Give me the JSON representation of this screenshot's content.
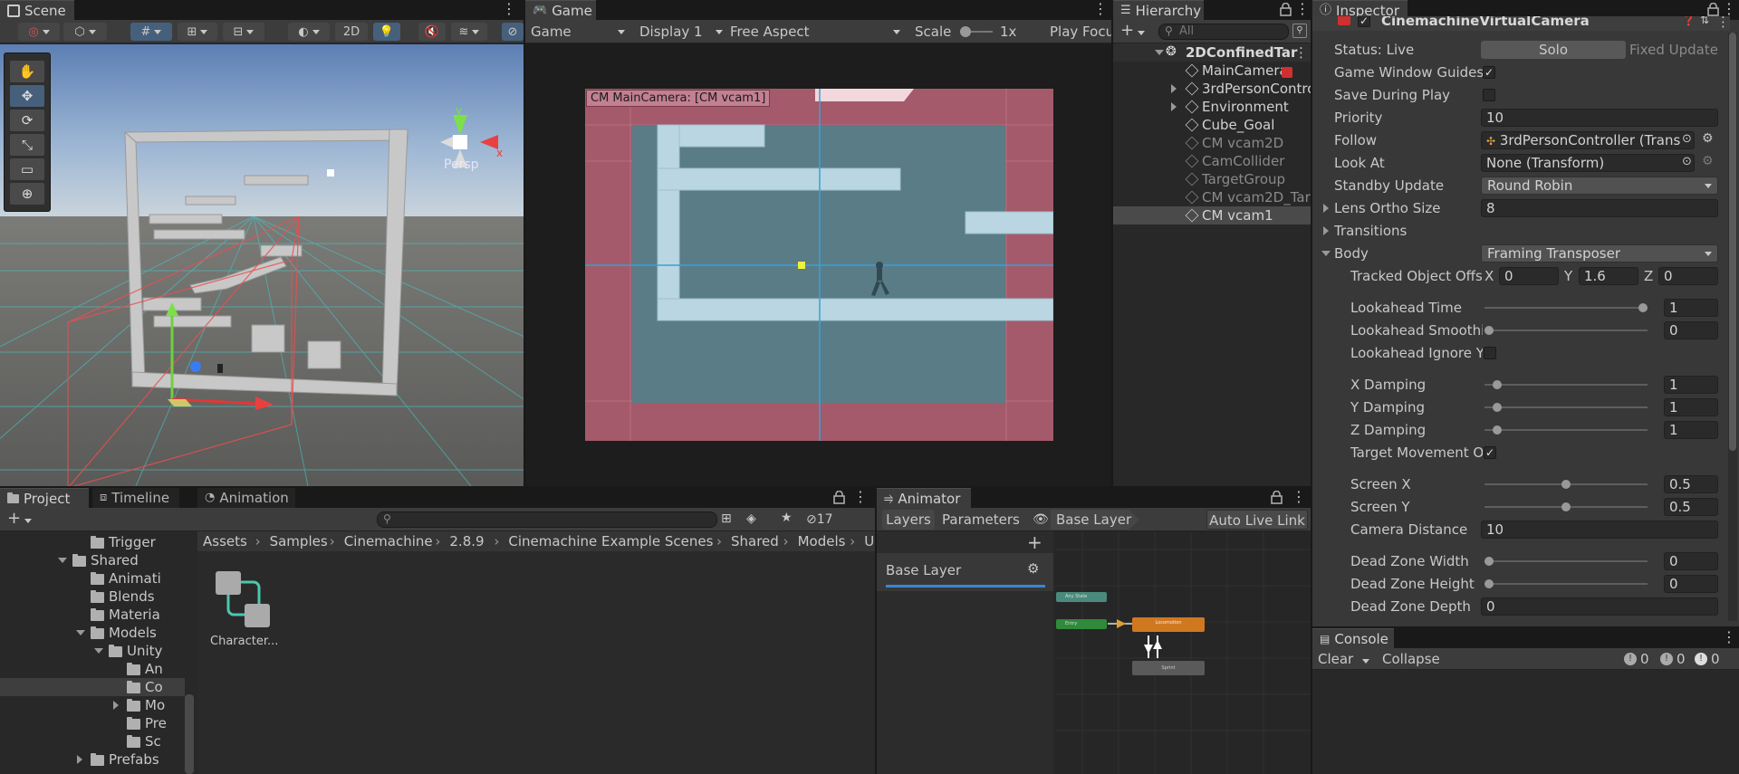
{
  "scene": {
    "tab": "Scene",
    "toolbar": {
      "mode_2d": "2D"
    },
    "persp_label": "Persp"
  },
  "game": {
    "tab": "Game",
    "toolbar": {
      "view": "Game",
      "display": "Display 1",
      "aspect": "Free Aspect",
      "scale_label": "Scale",
      "scale_value": "1x",
      "play_focus": "Play Focu"
    },
    "camera_label": "CM MainCamera: [CM vcam1]"
  },
  "hierarchy": {
    "tab": "Hierarchy",
    "search_placeholder": "All",
    "scene_name": "2DConfinedTar",
    "items": [
      {
        "label": "MainCamera",
        "dim": false,
        "expandable": false
      },
      {
        "label": "3rdPersonContro",
        "dim": false,
        "expandable": true
      },
      {
        "label": "Environment",
        "dim": false,
        "expandable": true
      },
      {
        "label": "Cube_Goal",
        "dim": false,
        "expandable": false
      },
      {
        "label": "CM vcam2D",
        "dim": true,
        "expandable": false
      },
      {
        "label": "CamCollider",
        "dim": true,
        "expandable": false
      },
      {
        "label": "TargetGroup",
        "dim": true,
        "expandable": false
      },
      {
        "label": "CM vcam2D_Tar",
        "dim": true,
        "expandable": false
      },
      {
        "label": "CM vcam1",
        "dim": false,
        "expandable": false,
        "selected": true
      }
    ]
  },
  "inspector": {
    "tab": "Inspector",
    "component": "CinemachineVirtualCamera",
    "status_label": "Status: Live",
    "solo": "Solo",
    "fixed_update": "Fixed Update",
    "game_window_guides": "Game Window Guides",
    "save_during_play": "Save During Play",
    "priority_label": "Priority",
    "priority": "10",
    "follow_label": "Follow",
    "follow": "3rdPersonController (Trans",
    "lookat_label": "Look At",
    "lookat": "None (Transform)",
    "standby_label": "Standby Update",
    "standby": "Round Robin",
    "lens_label": "Lens Ortho Size",
    "lens": "8",
    "transitions": "Transitions",
    "body_label": "Body",
    "body": "Framing Transposer",
    "tracked_label": "Tracked Object Offs",
    "tracked": {
      "x_label": "X",
      "x": "0",
      "y_label": "Y",
      "y": "1.6",
      "z_label": "Z",
      "z": "0"
    },
    "sliders": [
      {
        "label": "Lookahead Time",
        "value": "1",
        "pos": 1.0
      },
      {
        "label": "Lookahead Smoothi",
        "value": "0",
        "pos": 0.0
      },
      {
        "label": "X Damping",
        "value": "1",
        "pos": 0.05
      },
      {
        "label": "Y Damping",
        "value": "1",
        "pos": 0.05
      },
      {
        "label": "Z Damping",
        "value": "1",
        "pos": 0.05
      },
      {
        "label": "Screen X",
        "value": "0.5",
        "pos": 0.5
      },
      {
        "label": "Screen Y",
        "value": "0.5",
        "pos": 0.5
      },
      {
        "label": "Dead Zone Width",
        "value": "0",
        "pos": 0.0
      },
      {
        "label": "Dead Zone Height",
        "value": "0",
        "pos": 0.0
      }
    ],
    "lookahead_ignore_y": "Lookahead Ignore Y",
    "target_movement": "Target Movement O",
    "camera_distance_label": "Camera Distance",
    "camera_distance": "10",
    "dead_zone_depth_label": "Dead Zone Depth",
    "dead_zone_depth": "0"
  },
  "project": {
    "tabs": [
      "Project",
      "Timeline",
      "Animation"
    ],
    "hidden_count": "17",
    "breadcrumb": [
      "Assets",
      "Samples",
      "Cinemachine",
      "2.8.9",
      "Cinemachine Example Scenes",
      "Shared",
      "Models",
      "Uni"
    ],
    "tree": [
      {
        "label": "Trigger",
        "depth": 2,
        "open": null
      },
      {
        "label": "Shared",
        "depth": 1,
        "open": true
      },
      {
        "label": "Animati",
        "depth": 2,
        "open": null
      },
      {
        "label": "Blends",
        "depth": 2,
        "open": null
      },
      {
        "label": "Materia",
        "depth": 2,
        "open": null
      },
      {
        "label": "Models",
        "depth": 2,
        "open": true
      },
      {
        "label": "Unity",
        "depth": 3,
        "open": true
      },
      {
        "label": "An",
        "depth": 4,
        "open": null
      },
      {
        "label": "Co",
        "depth": 4,
        "open": null,
        "selected": true
      },
      {
        "label": "Mo",
        "depth": 4,
        "open": false
      },
      {
        "label": "Pre",
        "depth": 4,
        "open": null
      },
      {
        "label": "Sc",
        "depth": 4,
        "open": null
      },
      {
        "label": "Prefabs",
        "depth": 2,
        "open": false
      }
    ],
    "asset_name": "Character..."
  },
  "animator": {
    "tab": "Animator",
    "layers": "Layers",
    "parameters": "Parameters",
    "base_layer_crumb": "Base Layer",
    "auto_live_link": "Auto Live Link",
    "base_layer_item": "Base Layer",
    "states": {
      "any_state": "Any State",
      "entry": "Entry",
      "locomotion": "Locomotion",
      "sprint": "Sprint"
    }
  },
  "console": {
    "tab": "Console",
    "clear": "Clear",
    "collapse": "Collapse",
    "info_count": "0",
    "warn_count": "0",
    "error_count": "0"
  }
}
